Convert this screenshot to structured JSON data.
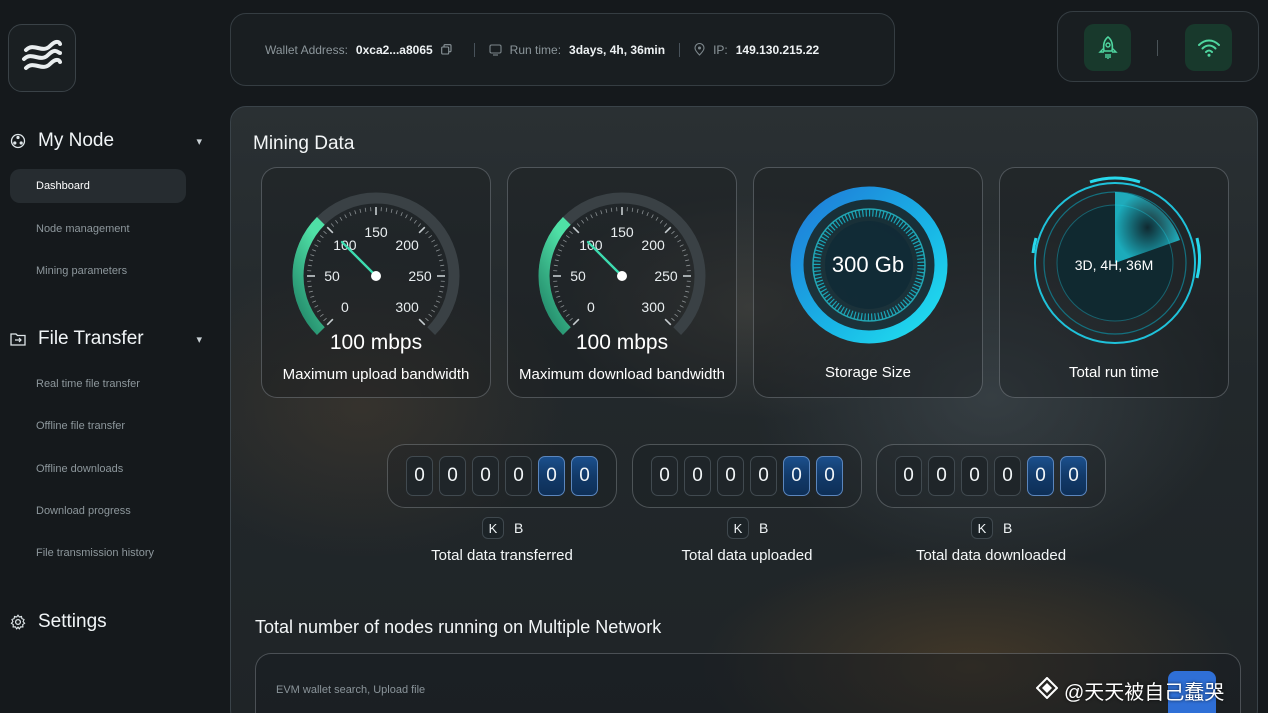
{
  "sidebar": {
    "groups": [
      {
        "label": "My Node",
        "icon": "network-node-icon",
        "items": [
          "Dashboard",
          "Node management",
          "Mining parameters"
        ]
      },
      {
        "label": "File Transfer",
        "icon": "folder-transfer-icon",
        "items": [
          "Real time file transfer",
          "Offline file transfer",
          "Offline downloads",
          "Download progress",
          "File transmission history"
        ]
      }
    ],
    "settings_label": "Settings",
    "active_item": "Dashboard"
  },
  "topbar": {
    "wallet_label": "Wallet Address:",
    "wallet_value": "0xca2...a8065",
    "runtime_label": "Run time:",
    "runtime_value": "3days, 4h, 36min",
    "ip_label": "IP:",
    "ip_value": "149.130.215.22"
  },
  "icons": {
    "rocket": "rocket-icon",
    "wifi": "wifi-icon",
    "copy": "copy-icon",
    "location": "location-pin-icon"
  },
  "colors": {
    "accent_green": "#3ddc97",
    "accent_cyan": "#1fd3e6",
    "counter_blue": "#1b4f8c",
    "search_blue": "#2f6fd6"
  },
  "mining": {
    "title": "Mining Data",
    "gauges": [
      {
        "value": 100,
        "display": "100 mbps",
        "label": "Maximum upload bandwidth",
        "ticks": [
          "0",
          "50",
          "100",
          "150",
          "200",
          "250",
          "300"
        ]
      },
      {
        "value": 100,
        "display": "100 mbps",
        "label": "Maximum download bandwidth",
        "ticks": [
          "0",
          "50",
          "100",
          "150",
          "200",
          "250",
          "300"
        ]
      }
    ],
    "storage": {
      "value": "300 Gb",
      "label": "Storage Size"
    },
    "runtime": {
      "value": "3D, 4H, 36M",
      "label": "Total run time"
    }
  },
  "counters": [
    {
      "digits": [
        "0",
        "0",
        "0",
        "0",
        "0",
        "0"
      ],
      "unit_k": "K",
      "unit_b": "B",
      "label": "Total data transferred"
    },
    {
      "digits": [
        "0",
        "0",
        "0",
        "0",
        "0",
        "0"
      ],
      "unit_k": "K",
      "unit_b": "B",
      "label": "Total data uploaded"
    },
    {
      "digits": [
        "0",
        "0",
        "0",
        "0",
        "0",
        "0"
      ],
      "unit_k": "K",
      "unit_b": "B",
      "label": "Total data downloaded"
    }
  ],
  "nodes": {
    "title": "Total number of nodes running on Multiple Network",
    "search_placeholder": "EVM wallet search, Upload file"
  },
  "watermark": "@天天被自己蠢哭"
}
